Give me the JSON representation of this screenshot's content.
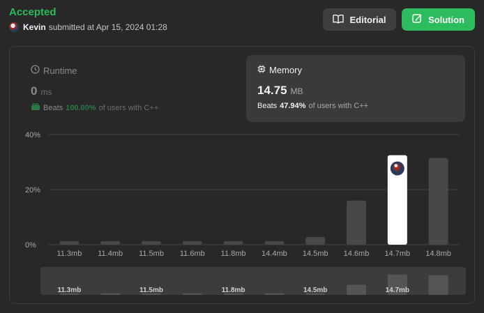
{
  "status": "Accepted",
  "submission": {
    "user": "Kevin",
    "text": "submitted at Apr 15, 2024 01:28"
  },
  "buttons": {
    "editorial": "Editorial",
    "solution": "Solution"
  },
  "colors": {
    "accent_green": "#2cbb5d",
    "card_bg": "#3a3a3a",
    "bar": "#484848",
    "bar_selected": "#ffffff"
  },
  "runtime": {
    "title": "Runtime",
    "value": "0",
    "unit": "ms",
    "beats_label": "Beats",
    "beats_pct": "100.00%",
    "beats_rest": "of users with C++",
    "icon": "clock-icon",
    "beats_icon": "gift-icon"
  },
  "memory": {
    "title": "Memory",
    "value": "14.75",
    "unit": "MB",
    "beats_label": "Beats",
    "beats_pct": "47.94%",
    "beats_rest": "of users with C++",
    "icon": "chip-icon"
  },
  "chart_data": {
    "type": "bar",
    "categories": [
      "11.3mb",
      "11.4mb",
      "11.5mb",
      "11.6mb",
      "11.8mb",
      "14.4mb",
      "14.5mb",
      "14.6mb",
      "14.7mb",
      "14.8mb"
    ],
    "values": [
      1.3,
      1.3,
      1.3,
      1.3,
      1.3,
      1.3,
      2.8,
      16,
      32.5,
      31.5
    ],
    "selected_category": "14.7mb",
    "yticks": [
      "0%",
      "20%",
      "40%"
    ],
    "ylim": [
      0,
      40
    ],
    "grid": true,
    "mini_labels": [
      "11.3mb",
      "11.5mb",
      "11.8mb",
      "14.5mb",
      "14.7mb"
    ]
  }
}
